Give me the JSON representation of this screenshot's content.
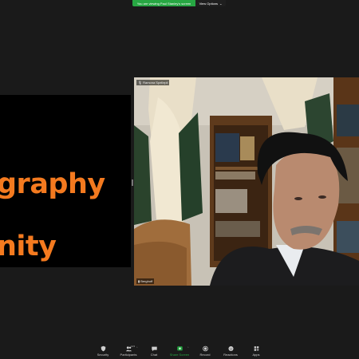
{
  "share_banner": {
    "message": "You are viewing Paul Stanley's screen",
    "view_options_label": "View Options",
    "view_options_caret": "⌄"
  },
  "shared_screen": {
    "line1": "graphy",
    "line2": "nity",
    "text_color": "#f47a1f"
  },
  "video_tile": {
    "top_name": "Ramona Spellepii",
    "bottom_name": "Berghoff"
  },
  "toolbar": {
    "items": [
      {
        "label": "Security",
        "icon": "shield-icon"
      },
      {
        "label": "Participants",
        "icon": "participants-icon",
        "count": "123"
      },
      {
        "label": "Chat",
        "icon": "chat-icon"
      },
      {
        "label": "Share Screen",
        "icon": "share-screen-icon"
      },
      {
        "label": "Record",
        "icon": "record-icon"
      },
      {
        "label": "Reactions",
        "icon": "reactions-icon"
      },
      {
        "label": "Apps",
        "icon": "apps-icon"
      }
    ]
  },
  "colors": {
    "background": "#1a1a1a",
    "accent_green": "#27a743"
  }
}
